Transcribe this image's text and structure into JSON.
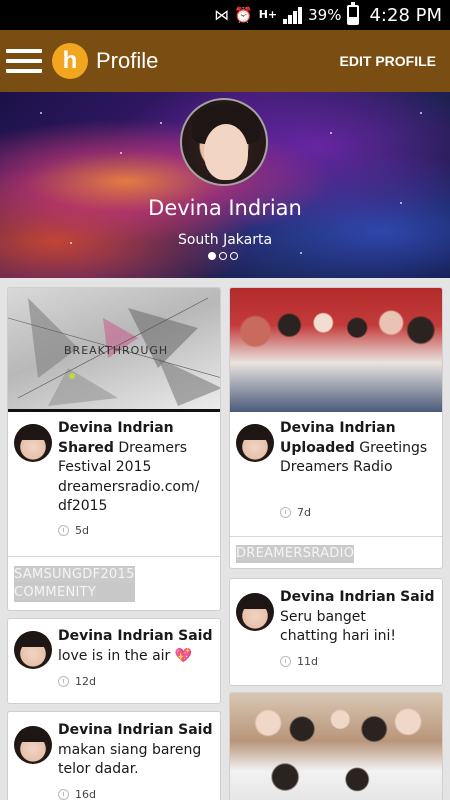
{
  "status_bar": {
    "network": "H+",
    "battery": "39%",
    "battery_level": 0.39,
    "time": "4:28 PM"
  },
  "app_bar": {
    "logo_letter": "h",
    "title": "Profile",
    "edit_label": "EDIT PROFILE"
  },
  "profile": {
    "name": "Devina Indrian",
    "location": "South Jakarta",
    "carousel_pages": 3,
    "carousel_active": 1
  },
  "feed": {
    "card_1": {
      "author": "Devina Indrian",
      "action": "Shared",
      "text_line1": "Dreamers",
      "text_line2": "Festival 2015",
      "text_line3": "dreamersradio.com/",
      "text_line4": "df2015",
      "time": "5d",
      "tag_line1": "SAMSUNGDF2015",
      "tag_line2": "COMMENITY",
      "image_text": "BREAKTHROUGH"
    },
    "card_2": {
      "author": "Devina Indrian",
      "action": "Uploaded",
      "text_line1": "Greetings",
      "text_line2": "Dreamers Radio",
      "time": "7d",
      "tag": "DREAMERSRADIO"
    },
    "card_3": {
      "author": "Devina Indrian",
      "action": "Said",
      "text": "love is in the air 💖",
      "time": "12d"
    },
    "card_4": {
      "author": "Devina Indrian",
      "action": "Said",
      "text_line1": "Seru banget",
      "text_line2": "chatting hari ini!",
      "time": "11d"
    },
    "card_5": {
      "author": "Devina Indrian",
      "action": "Said",
      "text_line1": "makan siang bareng",
      "text_line2": "telor dadar.",
      "time": "16d"
    }
  },
  "colors": {
    "app_bar": "#7a4e12",
    "logo": "#f2a51f",
    "background": "#e4e4e4"
  }
}
